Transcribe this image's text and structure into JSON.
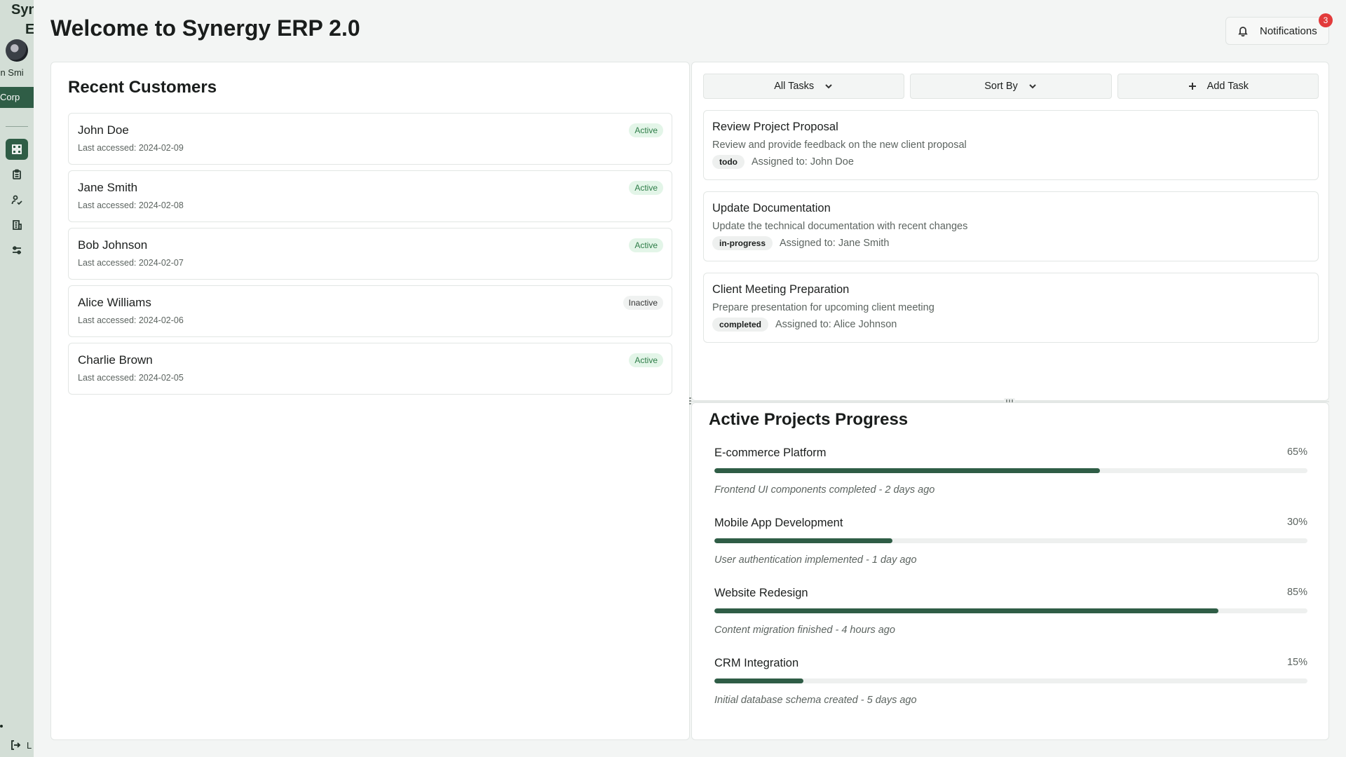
{
  "sidebar": {
    "brand_line1": "Syn",
    "brand_line2": "E",
    "user_name": "ohn Smi",
    "org_label": "Corp",
    "nav_icons": [
      "dashboard-icon",
      "clipboard-icon",
      "users-icon",
      "building-icon",
      "settings-sliders-icon"
    ],
    "logout_label": "L"
  },
  "header": {
    "title": "Welcome to Synergy ERP 2.0",
    "notifications_label": "Notifications",
    "notifications_count": "3"
  },
  "customers": {
    "title": "Recent Customers",
    "items": [
      {
        "name": "John Doe",
        "last_accessed": "Last accessed: 2024-02-09",
        "status": "Active"
      },
      {
        "name": "Jane Smith",
        "last_accessed": "Last accessed: 2024-02-08",
        "status": "Active"
      },
      {
        "name": "Bob Johnson",
        "last_accessed": "Last accessed: 2024-02-07",
        "status": "Active"
      },
      {
        "name": "Alice Williams",
        "last_accessed": "Last accessed: 2024-02-06",
        "status": "Inactive"
      },
      {
        "name": "Charlie Brown",
        "last_accessed": "Last accessed: 2024-02-05",
        "status": "Active"
      }
    ]
  },
  "tasks": {
    "toolbar": {
      "filter_label": "All Tasks",
      "sort_label": "Sort By",
      "add_label": "Add Task"
    },
    "items": [
      {
        "title": "Review Project Proposal",
        "description": "Review and provide feedback on the new client proposal",
        "status": "todo",
        "assigned": "Assigned to: John Doe"
      },
      {
        "title": "Update Documentation",
        "description": "Update the technical documentation with recent changes",
        "status": "in-progress",
        "assigned": "Assigned to: Jane Smith"
      },
      {
        "title": "Client Meeting Preparation",
        "description": "Prepare presentation for upcoming client meeting",
        "status": "completed",
        "assigned": "Assigned to: Alice Johnson"
      }
    ]
  },
  "projects": {
    "title": "Active Projects Progress",
    "items": [
      {
        "name": "E-commerce Platform",
        "percent_label": "65%",
        "progress": 65,
        "note": "Frontend UI components completed - 2 days ago"
      },
      {
        "name": "Mobile App Development",
        "percent_label": "30%",
        "progress": 30,
        "note": "User authentication implemented - 1 day ago"
      },
      {
        "name": "Website Redesign",
        "percent_label": "85%",
        "progress": 85,
        "note": "Content migration finished - 4 hours ago"
      },
      {
        "name": "CRM Integration",
        "percent_label": "15%",
        "progress": 15,
        "note": "Initial database schema created - 5 days ago"
      }
    ]
  },
  "colors": {
    "accent": "#2f5d46",
    "active_badge_bg": "#e3f5e8",
    "active_badge_text": "#2e7d48",
    "notification_badge": "#e23b3b"
  }
}
